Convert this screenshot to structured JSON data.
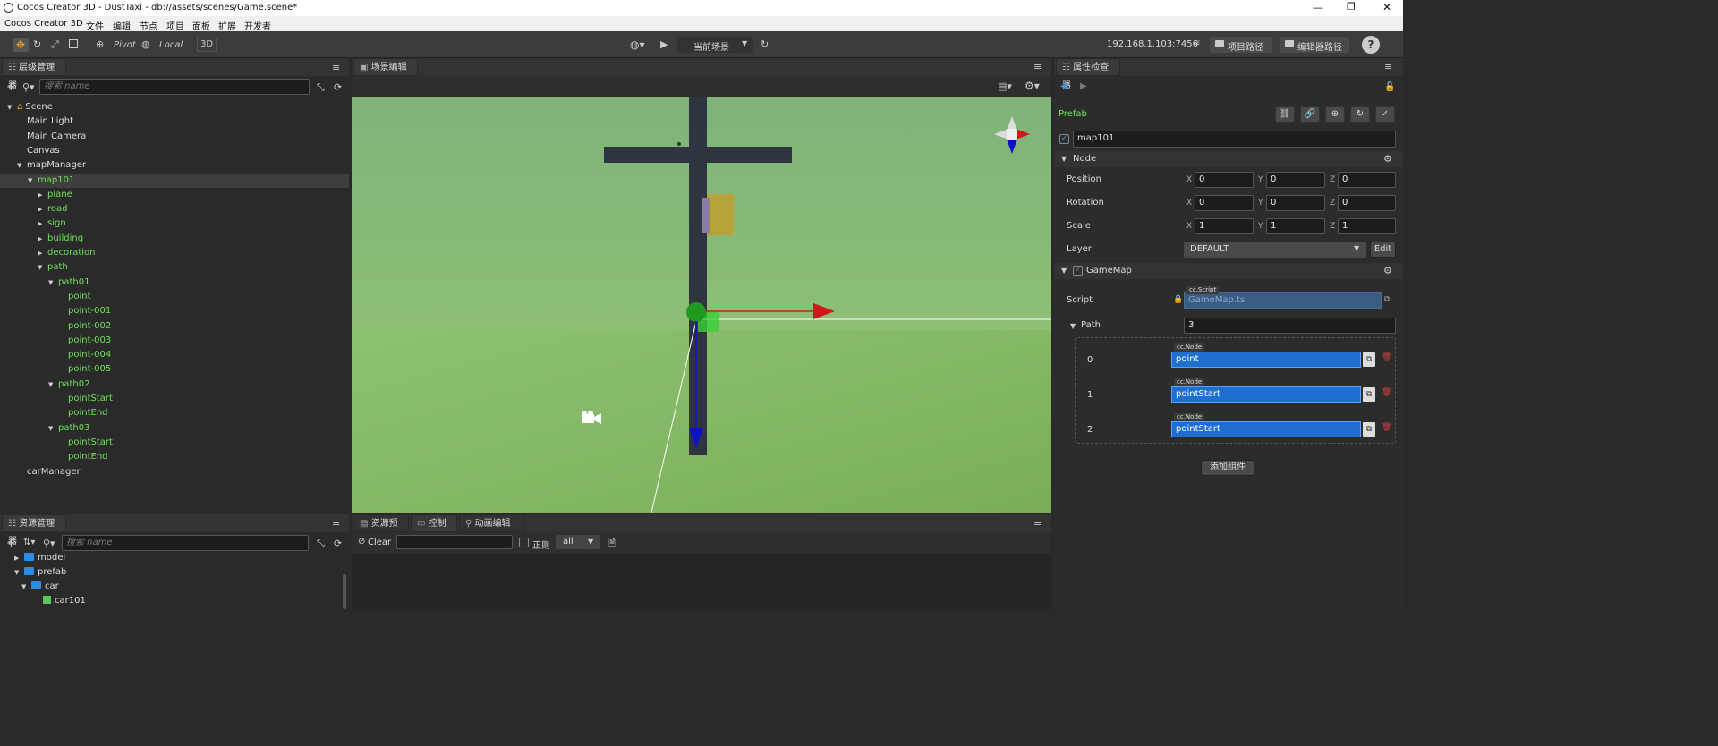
{
  "window": {
    "title": "Cocos Creator 3D - DustTaxi - db://assets/scenes/Game.scene*"
  },
  "menu": [
    "Cocos Creator 3D",
    "文件",
    "编辑",
    "节点",
    "项目",
    "面板",
    "扩展",
    "开发者"
  ],
  "toolbar": {
    "pivot": "Pivot",
    "local": "Local",
    "mode3d": "3D",
    "scene_select": "当前场景",
    "ip": "192.168.1.103:7456",
    "project_path": "项目路径",
    "editor_path": "编辑器路径",
    "help": "?"
  },
  "hierarchy": {
    "title": "层级管理器",
    "search_placeholder": "搜索 name",
    "nodes": [
      {
        "label": "Scene",
        "arrow": "▼"
      },
      {
        "label": "Main Light",
        "arrow": ""
      },
      {
        "label": "Main Camera",
        "arrow": ""
      },
      {
        "label": "Canvas",
        "arrow": ""
      },
      {
        "label": "mapManager",
        "arrow": "▼"
      },
      {
        "label": "map101",
        "arrow": "▼"
      },
      {
        "label": "plane",
        "arrow": "▶"
      },
      {
        "label": "road",
        "arrow": "▶"
      },
      {
        "label": "sign",
        "arrow": "▶"
      },
      {
        "label": "building",
        "arrow": "▶"
      },
      {
        "label": "decoration",
        "arrow": "▶"
      },
      {
        "label": "path",
        "arrow": "▼"
      },
      {
        "label": "path01",
        "arrow": "▼"
      },
      {
        "label": "point",
        "arrow": ""
      },
      {
        "label": "point-001",
        "arrow": ""
      },
      {
        "label": "point-002",
        "arrow": ""
      },
      {
        "label": "point-003",
        "arrow": ""
      },
      {
        "label": "point-004",
        "arrow": ""
      },
      {
        "label": "point-005",
        "arrow": ""
      },
      {
        "label": "path02",
        "arrow": "▼"
      },
      {
        "label": "pointStart",
        "arrow": ""
      },
      {
        "label": "pointEnd",
        "arrow": ""
      },
      {
        "label": "path03",
        "arrow": "▼"
      },
      {
        "label": "pointStart",
        "arrow": ""
      },
      {
        "label": "pointEnd",
        "arrow": ""
      },
      {
        "label": "carManager",
        "arrow": ""
      }
    ]
  },
  "assets": {
    "title": "资源管理器",
    "search_placeholder": "搜索 name",
    "items": [
      {
        "label": "model",
        "arrow": "▶"
      },
      {
        "label": "prefab",
        "arrow": "▼"
      },
      {
        "label": "car",
        "arrow": "▼"
      },
      {
        "label": "car101",
        "arrow": ""
      }
    ]
  },
  "scene_editor": {
    "title": "场景编辑器"
  },
  "bottom_tabs": {
    "preview": "资源预览",
    "console": "控制台",
    "animation": "动画编辑器",
    "clear": "Clear",
    "regex": "正则",
    "filter": "all"
  },
  "inspector": {
    "title": "属性检查器",
    "prefab_label": "Prefab",
    "node_name": "map101",
    "node_section": "Node",
    "position": {
      "label": "Position",
      "x": "0",
      "y": "0",
      "z": "0"
    },
    "rotation": {
      "label": "Rotation",
      "x": "0",
      "y": "0",
      "z": "0"
    },
    "scale": {
      "label": "Scale",
      "x": "1",
      "y": "1",
      "z": "1"
    },
    "axis": {
      "x": "X",
      "y": "Y",
      "z": "Z"
    },
    "layer": {
      "label": "Layer",
      "value": "DEFAULT",
      "edit": "Edit"
    },
    "component": "GameMap",
    "script": {
      "label": "Script",
      "tag": "cc.Script",
      "value": "GameMap.ts"
    },
    "path": {
      "label": "Path",
      "count": "3"
    },
    "path_items": [
      {
        "index": "0",
        "tag": "cc.Node",
        "value": "point"
      },
      {
        "index": "1",
        "tag": "cc.Node",
        "value": "pointStart"
      },
      {
        "index": "2",
        "tag": "cc.Node",
        "value": "pointStart"
      }
    ],
    "add_component": "添加组件"
  },
  "colors": {
    "accent": "#6fe05a",
    "selection": "#1f6fd0",
    "panel": "#2a2a2a"
  }
}
